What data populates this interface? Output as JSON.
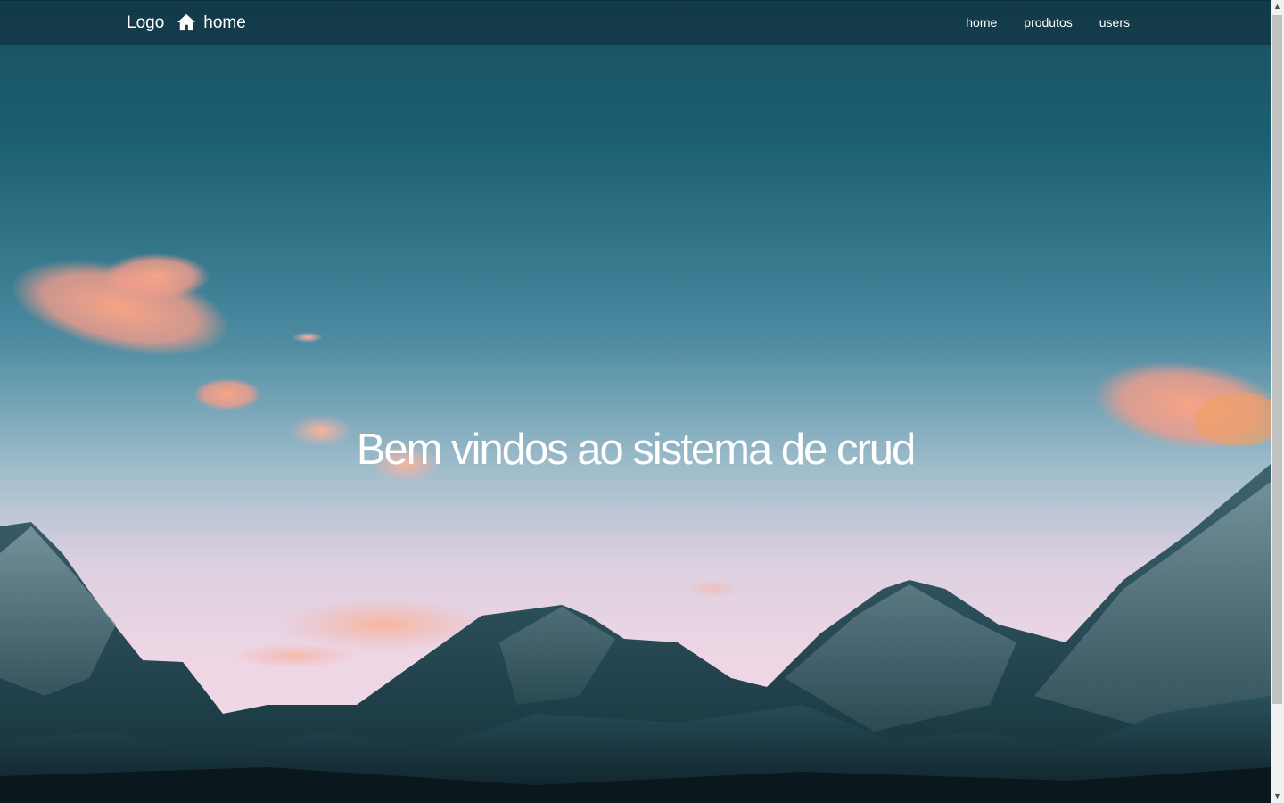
{
  "navbar": {
    "logo_label": "Logo",
    "home_brand_label": "home",
    "home_icon": "home-icon",
    "links": [
      {
        "label": "home"
      },
      {
        "label": "produtos"
      },
      {
        "label": "users"
      }
    ]
  },
  "hero": {
    "title": "Bem vindos ao sistema de crud",
    "background": "mountain-sunset-photo"
  },
  "colors": {
    "navbar_bg": "#123846",
    "text": "#ffffff",
    "sky_top": "#1d5b70",
    "sky_bottom": "#e8cfe0",
    "mountains": "#13303a"
  }
}
